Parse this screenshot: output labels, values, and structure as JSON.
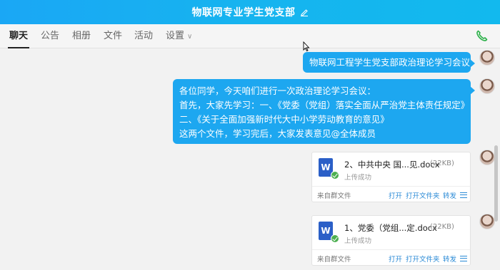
{
  "window": {
    "title": "物联网专业学生党支部",
    "accent_color": "#1da7f0",
    "edit_icon": "pencil-icon"
  },
  "tabs": [
    {
      "label": "聊天",
      "active": true
    },
    {
      "label": "公告",
      "active": false
    },
    {
      "label": "相册",
      "active": false
    },
    {
      "label": "文件",
      "active": false
    },
    {
      "label": "活动",
      "active": false
    },
    {
      "label": "设置",
      "active": false,
      "has_dropdown": true
    }
  ],
  "toolbar": {
    "call_icon": "phone-icon"
  },
  "messages": [
    {
      "type": "text",
      "text": "物联网工程学生党支部政治理论学习会议"
    },
    {
      "type": "text",
      "lines": [
        "各位同学，今天咱们进行一次政治理论学习会议：",
        "首先，大家先学习：一、《党委（党组）落实全面从严治党主体责任规定》",
        "二、《关于全面加强新时代大中小学劳动教育的意见》",
        "这两个文件，学习完后，大家发表意见@全体成员"
      ]
    },
    {
      "type": "file",
      "name": "2、中共中央 国...见.docx",
      "size": "(22KB)",
      "status": "上传成功",
      "source": "来自群文件",
      "actions": {
        "open": "打开",
        "open_folder": "打开文件夹",
        "forward": "转发"
      }
    },
    {
      "type": "file",
      "name": "1、党委（党组...定.docx",
      "size": "(22KB)",
      "status": "上传成功",
      "source": "来自群文件",
      "actions": {
        "open": "打开",
        "open_folder": "打开文件夹",
        "forward": "转发"
      }
    }
  ]
}
